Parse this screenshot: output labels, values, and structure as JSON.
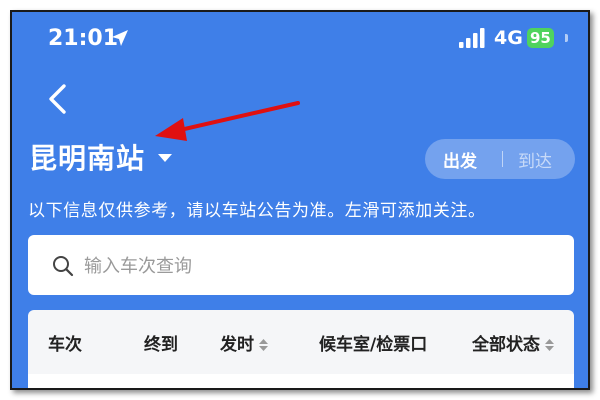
{
  "status_bar": {
    "time": "21:01",
    "network": "4G",
    "battery": "95"
  },
  "header": {
    "station": "昆明南站",
    "direction": {
      "depart": "出发",
      "arrive": "到达",
      "selected": "出发"
    }
  },
  "notice": "以下信息仅供参考，请以车站公告为准。左滑可添加关注。",
  "search": {
    "placeholder": "输入车次查询",
    "value": ""
  },
  "table": {
    "columns": [
      "车次",
      "终到",
      "发时",
      "候车室/检票口",
      "全部状态"
    ]
  },
  "colors": {
    "header_bg": "#3f7fe8",
    "battery": "#4fd35e",
    "annotation": "#e01010"
  }
}
